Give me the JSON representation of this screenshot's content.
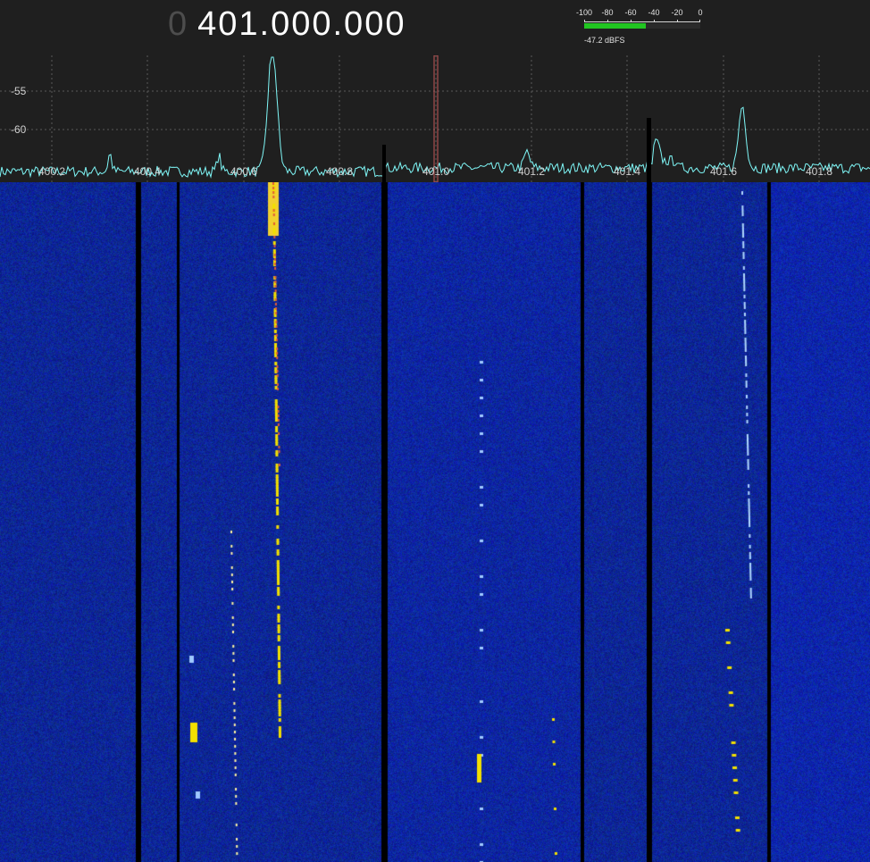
{
  "tuner": {
    "frequency_lead": "0",
    "frequency": "401.000.000"
  },
  "level_meter": {
    "scale_labels": [
      "-100",
      "-80",
      "-60",
      "-40",
      "-20",
      "0"
    ],
    "level_dbfs": -47.2,
    "readout": "-47.2 dBFS",
    "bar_color": "#21c521"
  },
  "spectrum": {
    "db_labels": [
      "-55",
      "-60"
    ],
    "freq_labels": [
      "400.2",
      "400.4",
      "400.6",
      "400.8",
      "401.0",
      "401.2",
      "401.4",
      "401.6",
      "401.8"
    ],
    "trace_color": "#7ff7f7",
    "grid_color": "#5a5a5a",
    "marker_color": "#c45a5a"
  },
  "waterfall": {
    "background_color": "#0d1a9c",
    "signal_color": "#f2e000",
    "channel_gap_color": "#000000"
  }
}
